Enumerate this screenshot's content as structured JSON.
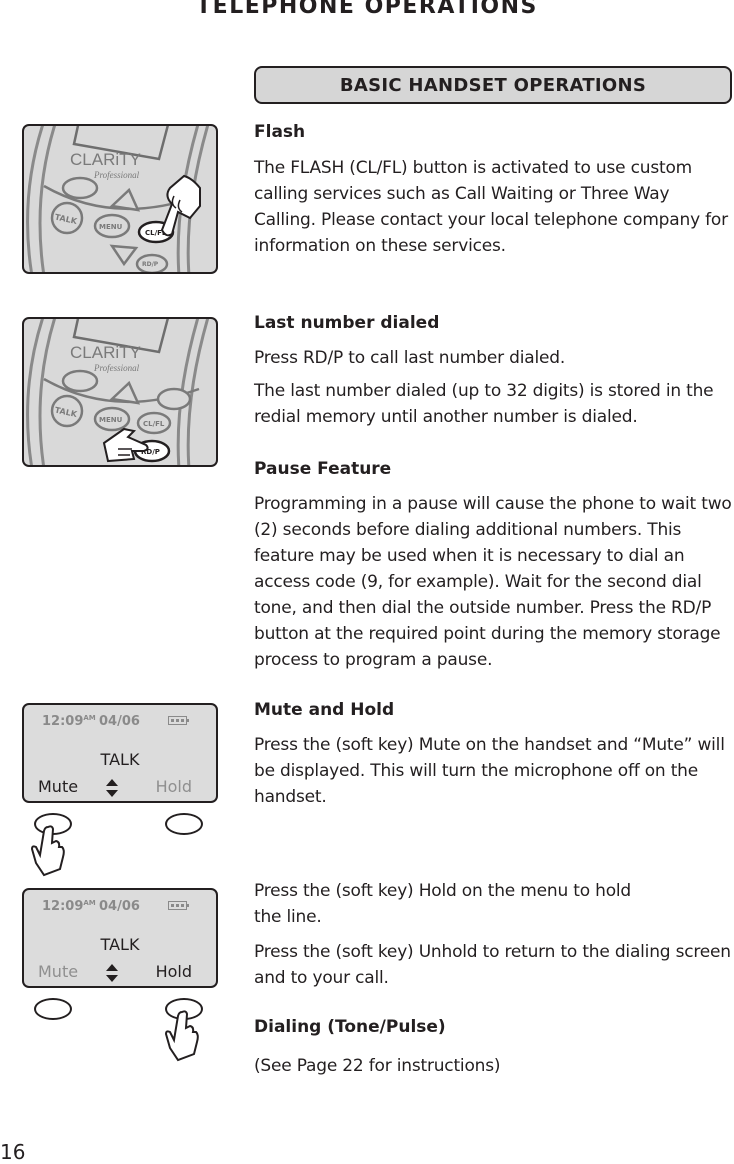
{
  "page": {
    "title": "TELEPHONE OPERATIONS",
    "section_header": "BASIC HANDSET OPERATIONS",
    "page_number": "16"
  },
  "sections": {
    "flash": {
      "heading": "Flash",
      "body": "The FLASH (CL/FL) button is activated to use custom calling services such as Call Waiting or Three Way Calling. Please contact your local telephone company for information on these services."
    },
    "last_number": {
      "heading": "Last number dialed",
      "body1": "Press RD/P to call last number dialed.",
      "body2": "The last number dialed (up to 32 digits) is stored in the redial memory until another number is dialed."
    },
    "pause": {
      "heading": "Pause Feature",
      "body": "Programming in a pause will cause the phone to wait two (2) seconds before dialing additional numbers. This feature may be used when it is necessary to dial an access code (9, for example). Wait for the second dial tone, and then dial the outside number. Press the RD/P button at the required point during the memory storage process to program a pause."
    },
    "mute_hold": {
      "heading": "Mute and Hold",
      "body1": "Press the (soft key) Mute on the handset and “Mute” will be displayed. This will turn the microphone off on the handset.",
      "body2": "Press the (soft key) Hold on the menu to hold the line.",
      "body3": "Press the (soft key) Unhold to return to the dialing screen and to your call."
    },
    "dialing": {
      "heading": "Dialing (Tone/Pulse)",
      "body": "(See Page 22 for instructions)"
    }
  },
  "handset_figure": {
    "brand": "CLARiTY",
    "brand_sub": "Professional",
    "keys": {
      "talk": "TALK",
      "menu": "MENU",
      "flash": "CL/FL",
      "redial": "RD/P"
    }
  },
  "lcd_screens": [
    {
      "time": "12:09",
      "ampm": "AM",
      "date": "04/06",
      "mode": "TALK",
      "left_softkey": "Mute",
      "right_softkey": "Hold",
      "active": "left"
    },
    {
      "time": "12:09",
      "ampm": "AM",
      "date": "04/06",
      "mode": "TALK",
      "left_softkey": "Mute",
      "right_softkey": "Hold",
      "active": "right"
    }
  ]
}
